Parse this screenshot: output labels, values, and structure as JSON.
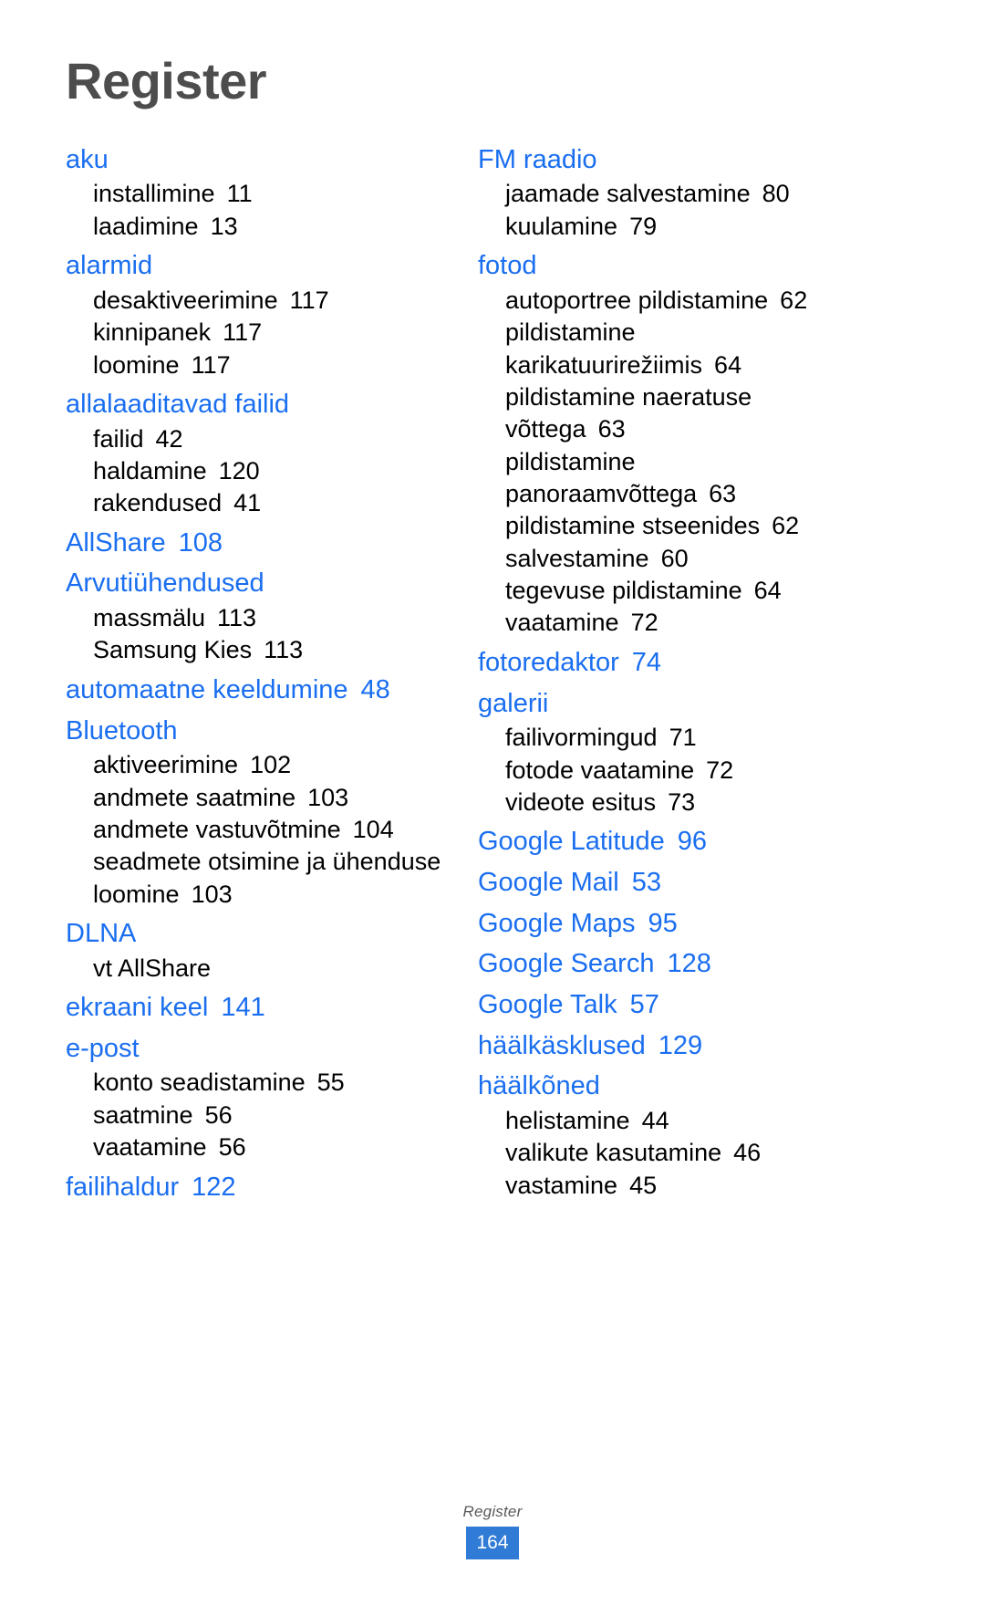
{
  "page": {
    "title": "Register",
    "footer_label": "Register",
    "footer_page": "164",
    "accent_color": "#1a6ef0",
    "title_color": "#4d4d4d",
    "footer_badge_color": "#2f7bd6"
  },
  "columns": [
    {
      "entries": [
        {
          "headword": "aku",
          "page": "",
          "subs": [
            {
              "text": "installimine",
              "page": "11"
            },
            {
              "text": "laadimine",
              "page": "13"
            }
          ]
        },
        {
          "headword": "alarmid",
          "page": "",
          "subs": [
            {
              "text": "desaktiveerimine",
              "page": "117"
            },
            {
              "text": "kinnipanek",
              "page": "117"
            },
            {
              "text": "loomine",
              "page": "117"
            }
          ]
        },
        {
          "headword": "allalaaditavad failid",
          "page": "",
          "subs": [
            {
              "text": "failid",
              "page": "42"
            },
            {
              "text": "haldamine",
              "page": "120"
            },
            {
              "text": "rakendused",
              "page": "41"
            }
          ]
        },
        {
          "headword": "AllShare",
          "page": "108",
          "subs": []
        },
        {
          "headword": "Arvutiühendused",
          "page": "",
          "subs": [
            {
              "text": "massmälu",
              "page": "113"
            },
            {
              "text": "Samsung Kies",
              "page": "113"
            }
          ]
        },
        {
          "headword": "automaatne keeldumine",
          "page": "48",
          "subs": []
        },
        {
          "headword": "Bluetooth",
          "page": "",
          "subs": [
            {
              "text": "aktiveerimine",
              "page": "102"
            },
            {
              "text": "andmete saatmine",
              "page": "103"
            },
            {
              "text": "andmete vastuvõtmine",
              "page": "104"
            },
            {
              "text": "seadmete otsimine ja ühenduse loomine",
              "page": "103"
            }
          ]
        },
        {
          "headword": "DLNA",
          "page": "",
          "subs": [
            {
              "text": "vt AllShare",
              "page": ""
            }
          ]
        },
        {
          "headword": "ekraani keel",
          "page": "141",
          "subs": []
        },
        {
          "headword": "e-post",
          "page": "",
          "subs": [
            {
              "text": "konto seadistamine",
              "page": "55"
            },
            {
              "text": "saatmine",
              "page": "56"
            },
            {
              "text": "vaatamine",
              "page": "56"
            }
          ]
        },
        {
          "headword": "failihaldur",
          "page": "122",
          "subs": []
        }
      ]
    },
    {
      "entries": [
        {
          "headword": "FM raadio",
          "page": "",
          "subs": [
            {
              "text": "jaamade salvestamine",
              "page": "80"
            },
            {
              "text": "kuulamine",
              "page": "79"
            }
          ]
        },
        {
          "headword": "fotod",
          "page": "",
          "subs": [
            {
              "text": "autoportree pildistamine",
              "page": "62"
            },
            {
              "text": "pildistamine karikatuurirežiimis",
              "page": "64"
            },
            {
              "text": "pildistamine naeratuse võttega",
              "page": "63"
            },
            {
              "text": "pildistamine panoraamvõttega",
              "page": "63"
            },
            {
              "text": "pildistamine stseenides",
              "page": "62"
            },
            {
              "text": "salvestamine",
              "page": "60"
            },
            {
              "text": "tegevuse pildistamine",
              "page": "64"
            },
            {
              "text": "vaatamine",
              "page": "72"
            }
          ]
        },
        {
          "headword": "fotoredaktor",
          "page": "74",
          "subs": []
        },
        {
          "headword": "galerii",
          "page": "",
          "subs": [
            {
              "text": "failivormingud",
              "page": "71"
            },
            {
              "text": "fotode vaatamine",
              "page": "72"
            },
            {
              "text": "videote esitus",
              "page": "73"
            }
          ]
        },
        {
          "headword": "Google Latitude",
          "page": "96",
          "subs": []
        },
        {
          "headword": "Google Mail",
          "page": "53",
          "subs": []
        },
        {
          "headword": "Google Maps",
          "page": "95",
          "subs": []
        },
        {
          "headword": "Google Search",
          "page": "128",
          "subs": []
        },
        {
          "headword": "Google Talk",
          "page": "57",
          "subs": []
        },
        {
          "headword": "häälkäsklused",
          "page": "129",
          "subs": []
        },
        {
          "headword": "häälkõned",
          "page": "",
          "subs": [
            {
              "text": "helistamine",
              "page": "44"
            },
            {
              "text": "valikute kasutamine",
              "page": "46"
            },
            {
              "text": "vastamine",
              "page": "45"
            }
          ]
        }
      ]
    }
  ]
}
